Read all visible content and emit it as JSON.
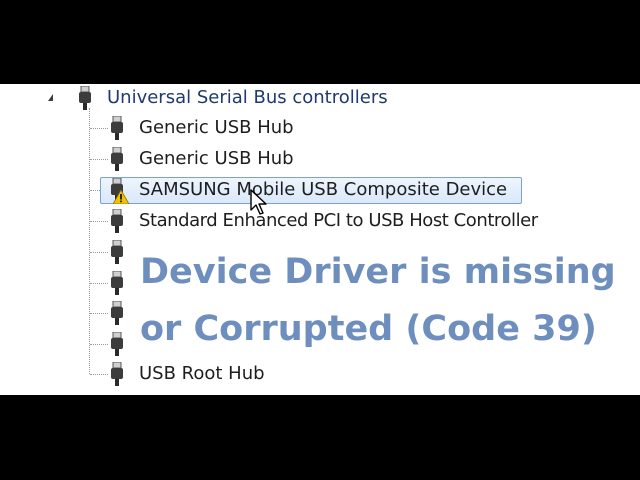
{
  "tree": {
    "category": "Universal Serial Bus controllers",
    "items": [
      {
        "label": "Generic USB Hub",
        "icon": "usb-plug-icon"
      },
      {
        "label": "Generic USB Hub",
        "icon": "usb-plug-icon"
      },
      {
        "label": "SAMSUNG Mobile USB Composite Device",
        "icon": "usb-plug-icon",
        "status": "warning",
        "selected": true
      },
      {
        "label": "Standard Enhanced PCI to USB Host Controller",
        "icon": "usb-plug-icon"
      },
      {
        "label": "",
        "icon": "usb-plug-icon"
      },
      {
        "label": "",
        "icon": "usb-plug-icon"
      },
      {
        "label": "",
        "icon": "usb-plug-icon"
      },
      {
        "label": "",
        "icon": "usb-plug-icon"
      },
      {
        "label": "USB Root Hub",
        "icon": "usb-plug-icon"
      }
    ]
  },
  "overlay": {
    "line1": "Device Driver is missing",
    "line2": "or Corrupted (Code 39)",
    "color": "#6e8fbd"
  },
  "colors": {
    "background": "#000000",
    "panel": "#ffffff",
    "selection_border": "#7da2ce",
    "warning": "#f2c200"
  }
}
